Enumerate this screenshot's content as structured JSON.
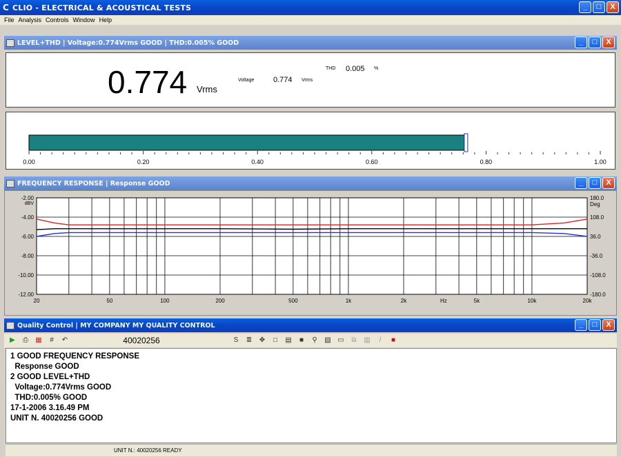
{
  "app": {
    "title": "CLIO - ELECTRICAL & ACOUSTICAL TESTS"
  },
  "menu": [
    "File",
    "Analysis",
    "Controls",
    "Window",
    "Help"
  ],
  "level": {
    "title": "LEVEL+THD  |  Voltage:0.774Vrms GOOD  |  THD:0.005% GOOD",
    "value": "0.774",
    "unit": "Vrms",
    "voltage_label": "Voltage",
    "voltage_value": "0.774",
    "voltage_unit": "Vrms",
    "thd_label": "THD",
    "thd_value": "0.005",
    "thd_unit": "%",
    "bar_fraction": 0.774,
    "scale": [
      "0.00",
      "0.20",
      "0.40",
      "0.60",
      "0.80",
      "1.00"
    ],
    "bar_color": "#1a8080"
  },
  "freq": {
    "title": "FREQUENCY RESPONSE  |  Response GOOD",
    "left_unit": "dBV",
    "right_unit": "Deg",
    "x_unit": "Hz",
    "y_ticks": [
      "-2.00",
      "-4.00",
      "-6.00",
      "-8.00",
      "-10.00",
      "-12.00"
    ],
    "right_ticks": [
      "180.0",
      "108.0",
      "36.0",
      "-36.0",
      "-108.0",
      "-180.0"
    ],
    "x_ticks": [
      "20",
      "50",
      "100",
      "200",
      "500",
      "1k",
      "2k",
      "5k",
      "10k",
      "20k"
    ],
    "chart_data": {
      "type": "line",
      "x": [
        20,
        25,
        30,
        50,
        100,
        200,
        500,
        1000,
        2000,
        5000,
        10000,
        15000,
        20000
      ],
      "xlim": [
        20,
        20000
      ],
      "ylim": [
        -12,
        -2
      ],
      "series": [
        {
          "color": "#e02020",
          "values": [
            -4.2,
            -4.6,
            -4.8,
            -4.8,
            -4.8,
            -4.8,
            -4.8,
            -4.8,
            -4.8,
            -4.8,
            -4.8,
            -4.6,
            -4.2
          ]
        },
        {
          "color": "#000000",
          "values": [
            -5.3,
            -5.2,
            -5.2,
            -5.2,
            -5.2,
            -5.2,
            -5.25,
            -5.2,
            -5.2,
            -5.2,
            -5.2,
            -5.2,
            -5.2
          ]
        },
        {
          "color": "#2030e0",
          "values": [
            -6.0,
            -5.7,
            -5.6,
            -5.6,
            -5.6,
            -5.6,
            -5.6,
            -5.6,
            -5.6,
            -5.6,
            -5.6,
            -5.7,
            -6.0
          ]
        }
      ]
    }
  },
  "qc": {
    "title": "Quality Control  |  MY COMPANY  MY QUALITY CONTROL",
    "unit": "40020256",
    "log": "1 GOOD FREQUENCY RESPONSE\n  Response GOOD\n2 GOOD LEVEL+THD\n  Voltage:0.774Vrms GOOD\n  THD:0.005% GOOD\n17-1-2006 3.16.49 PM\nUNIT N. 40020256 GOOD",
    "status": "UNIT N.: 40020256 READY"
  }
}
